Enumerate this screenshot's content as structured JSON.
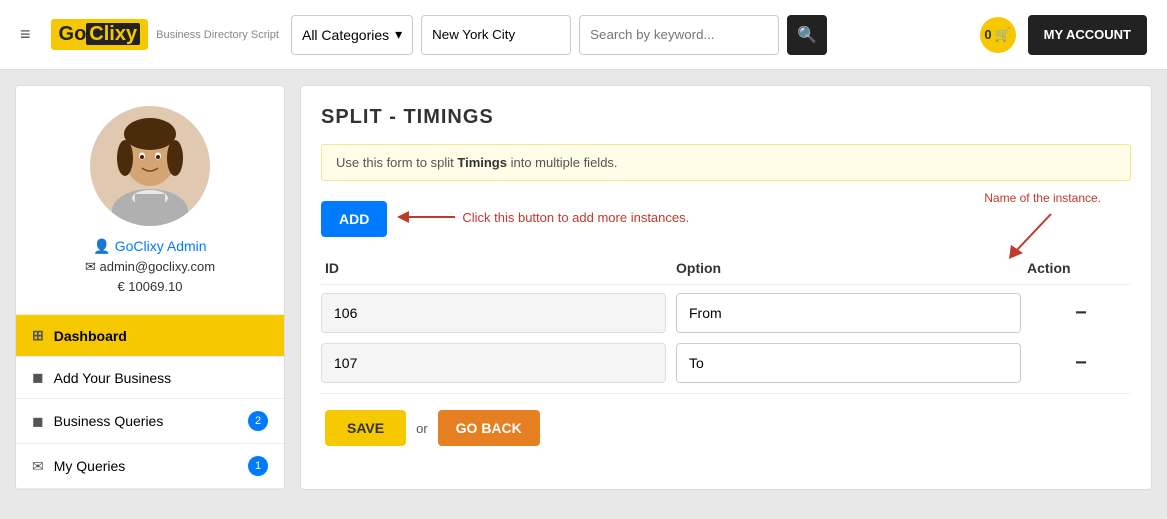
{
  "header": {
    "logo_go": "Go",
    "logo_clixy": "Clixy",
    "logo_subtitle": "Business Directory Script",
    "hamburger": "≡",
    "category_label": "All Categories",
    "location_value": "New York City",
    "search_placeholder": "Search by keyword...",
    "cart_count": "0",
    "my_account_label": "MY ACCOUNT"
  },
  "sidebar": {
    "profile_name": "GoClixy Admin",
    "profile_email": "admin@goclixy.com",
    "profile_balance": "€ 10069.10",
    "menu_items": [
      {
        "label": "Dashboard",
        "icon": "⊞",
        "active": true,
        "badge": null
      },
      {
        "label": "Add Your Business",
        "icon": "◼",
        "active": false,
        "badge": null
      },
      {
        "label": "Business Queries",
        "icon": "◼",
        "active": false,
        "badge": "2"
      },
      {
        "label": "My Queries",
        "icon": "✉",
        "active": false,
        "badge": "1"
      }
    ]
  },
  "content": {
    "page_title": "SPLIT - TIMINGS",
    "info_text": "Use this form to split ",
    "info_bold": "Timings",
    "info_text2": " into multiple fields.",
    "add_button_label": "ADD",
    "annotation_arrow_text": "Click this button to add more instances.",
    "instance_label_text": "Name of the instance.",
    "table_headers": {
      "id": "ID",
      "option": "Option",
      "action": "Action"
    },
    "rows": [
      {
        "id": "106",
        "option": "From",
        "action_label": "−"
      },
      {
        "id": "107",
        "option": "To",
        "action_label": "−"
      }
    ],
    "save_label": "SAVE",
    "or_label": "or",
    "go_back_label": "GO BACK"
  }
}
